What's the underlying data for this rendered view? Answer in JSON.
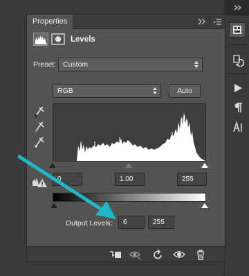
{
  "panel": {
    "tab_title": "Properties",
    "adjustment_title": "Levels",
    "preset_label": "Preset:",
    "preset_value": "Custom",
    "channel_value": "RGB",
    "auto_label": "Auto",
    "input_levels": {
      "black": "0",
      "gamma": "1.00",
      "white": "255"
    },
    "output_levels_label": "Output Levels:",
    "output_levels": {
      "black": "6",
      "white": "255"
    }
  },
  "icons": {
    "tab_menu": "double-chevron-icon",
    "panel_menu": "panel-menu-icon",
    "adjustment_layer": "levels-histogram-icon",
    "layer_mask": "layer-mask-icon",
    "eyedropper_black": "eyedropper-icon",
    "eyedropper_gray": "eyedropper-icon",
    "eyedropper_white": "eyedropper-icon",
    "clipping_warning": "clipping-warning-icon",
    "clip_to_layer": "clip-to-layer-icon",
    "view_previous": "eye-previous-icon",
    "reset": "reset-icon",
    "visibility": "eye-icon",
    "delete": "trash-icon",
    "dock": [
      "properties-icon",
      "history-icon",
      "actions-play-icon",
      "paragraph-icon",
      "character-icon"
    ]
  },
  "colors": {
    "panel_bg": "#535353",
    "histogram_bg": "#3e3e3e",
    "histogram_fill": "#ffffff",
    "annotation_arrow": "#1fb8c8"
  }
}
